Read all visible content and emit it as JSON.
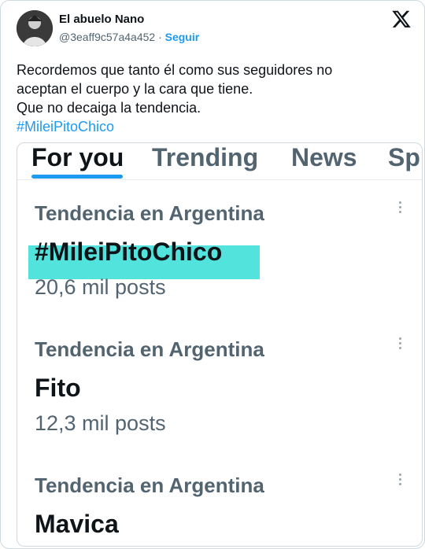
{
  "tweet": {
    "author_name": "El abuelo Nano",
    "handle": "@3eaff9c57a4a452",
    "separator": "·",
    "follow_label": "Seguir",
    "text_lines": [
      "Recordemos que tanto él como sus seguidores no",
      "aceptan el cuerpo y la cara que tiene.",
      "Que no decaiga la tendencia."
    ],
    "hashtag": "#MileiPitoChico"
  },
  "embedded": {
    "tabs": [
      "For you",
      "Trending",
      "News",
      "Sp"
    ],
    "active_tab": "For you",
    "trends": [
      {
        "context": "Tendencia en Argentina",
        "name": "#MileiPitoChico",
        "count": "20,6 mil posts"
      },
      {
        "context": "Tendencia en Argentina",
        "name": "Fito",
        "count": "12,3 mil posts"
      },
      {
        "context": "Tendencia en Argentina",
        "name": "Mavica",
        "count": ""
      }
    ]
  },
  "icons": {
    "platform_logo": "x-logo-icon",
    "trend_menu": "more-vertical-icon"
  },
  "colors": {
    "link": "#1d9bf0",
    "highlight": "#3fe0d8",
    "secondary_text": "#536471"
  }
}
